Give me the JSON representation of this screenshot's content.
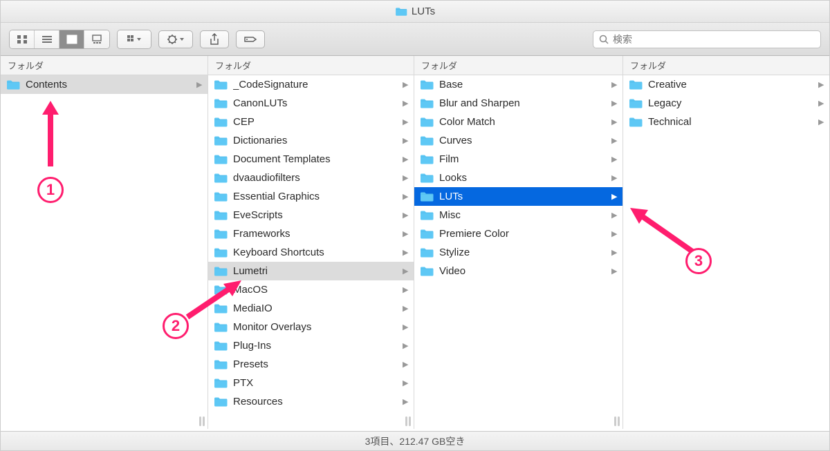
{
  "window": {
    "title": "LUTs"
  },
  "toolbar": {
    "search_placeholder": "検索"
  },
  "columns": {
    "header_label": "フォルダ",
    "col1": [
      {
        "label": "Contents",
        "state": "path"
      }
    ],
    "col2": [
      {
        "label": "_CodeSignature",
        "state": ""
      },
      {
        "label": "CanonLUTs",
        "state": ""
      },
      {
        "label": "CEP",
        "state": ""
      },
      {
        "label": "Dictionaries",
        "state": ""
      },
      {
        "label": "Document Templates",
        "state": ""
      },
      {
        "label": "dvaaudiofilters",
        "state": ""
      },
      {
        "label": "Essential Graphics",
        "state": ""
      },
      {
        "label": "EveScripts",
        "state": ""
      },
      {
        "label": "Frameworks",
        "state": ""
      },
      {
        "label": "Keyboard Shortcuts",
        "state": ""
      },
      {
        "label": "Lumetri",
        "state": "path"
      },
      {
        "label": "MacOS",
        "state": ""
      },
      {
        "label": "MediaIO",
        "state": ""
      },
      {
        "label": "Monitor Overlays",
        "state": ""
      },
      {
        "label": "Plug-Ins",
        "state": ""
      },
      {
        "label": "Presets",
        "state": ""
      },
      {
        "label": "PTX",
        "state": ""
      },
      {
        "label": "Resources",
        "state": ""
      }
    ],
    "col3": [
      {
        "label": "Base",
        "state": ""
      },
      {
        "label": "Blur and Sharpen",
        "state": ""
      },
      {
        "label": "Color Match",
        "state": ""
      },
      {
        "label": "Curves",
        "state": ""
      },
      {
        "label": "Film",
        "state": ""
      },
      {
        "label": "Looks",
        "state": ""
      },
      {
        "label": "LUTs",
        "state": "active"
      },
      {
        "label": "Misc",
        "state": ""
      },
      {
        "label": "Premiere Color",
        "state": ""
      },
      {
        "label": "Stylize",
        "state": ""
      },
      {
        "label": "Video",
        "state": ""
      }
    ],
    "col4": [
      {
        "label": "Creative",
        "state": ""
      },
      {
        "label": "Legacy",
        "state": ""
      },
      {
        "label": "Technical",
        "state": ""
      }
    ]
  },
  "status": {
    "text": "3項目、212.47 GB空き"
  },
  "annotations": {
    "a1": "1",
    "a2": "2",
    "a3": "3"
  }
}
